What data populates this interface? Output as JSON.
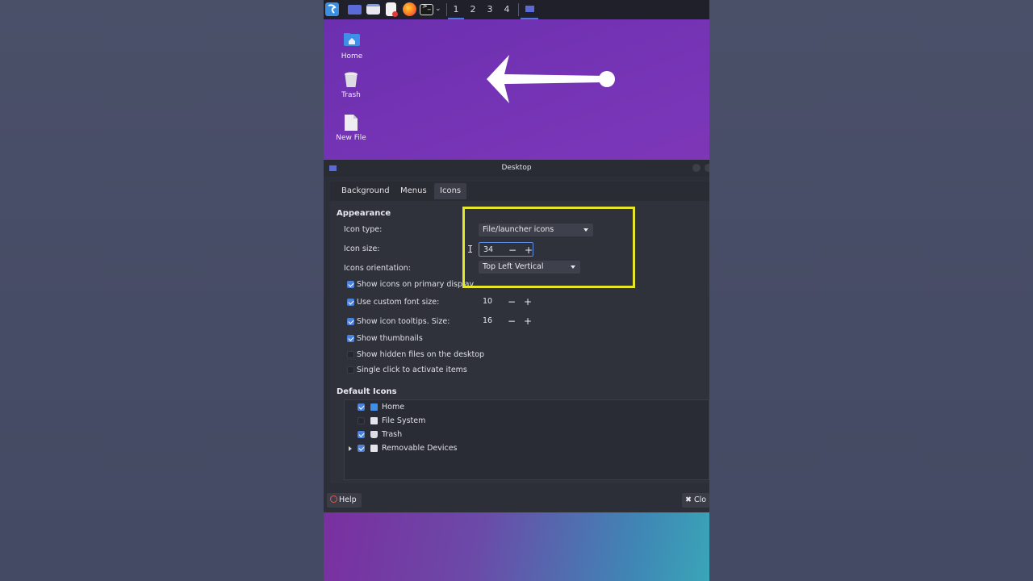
{
  "taskbar": {
    "workspaces": [
      "1",
      "2",
      "3",
      "4"
    ],
    "active_workspace": "1",
    "icons": [
      "app-menu-icon",
      "desktop-icon",
      "file-manager-icon",
      "text-editor-icon",
      "firefox-icon",
      "terminal-icon",
      "chevron-down-icon",
      "window-icon"
    ]
  },
  "desktop": {
    "icons": [
      {
        "label": "Home",
        "icon": "home-folder-icon"
      },
      {
        "label": "Trash",
        "icon": "trash-icon"
      },
      {
        "label": "New File",
        "icon": "file-icon"
      }
    ]
  },
  "dialog": {
    "title": "Desktop",
    "tabs": [
      "Background",
      "Menus",
      "Icons"
    ],
    "active_tab": "Icons",
    "appearance": {
      "heading": "Appearance",
      "icon_type_label": "Icon type:",
      "icon_type_value": "File/launcher icons",
      "icon_size_label": "Icon size:",
      "icon_size_value": "34",
      "orientation_label": "Icons orientation:",
      "orientation_value": "Top Left Vertical",
      "options": [
        {
          "label": "Show icons on primary display",
          "checked": true
        },
        {
          "label": "Use custom font size:",
          "checked": true,
          "value": "10"
        },
        {
          "label": "Show icon tooltips. Size:",
          "checked": true,
          "value": "16"
        },
        {
          "label": "Show thumbnails",
          "checked": true
        },
        {
          "label": "Show hidden files on the desktop",
          "checked": false
        },
        {
          "label": "Single click to activate items",
          "checked": false
        }
      ]
    },
    "default_icons": {
      "heading": "Default Icons",
      "items": [
        {
          "label": "Home",
          "checked": true,
          "icon": "home-icon"
        },
        {
          "label": "File System",
          "checked": false,
          "icon": "drive-icon"
        },
        {
          "label": "Trash",
          "checked": true,
          "icon": "trash-icon"
        },
        {
          "label": "Removable Devices",
          "checked": true,
          "icon": "removable-drive-icon",
          "expandable": true
        }
      ]
    },
    "help_label": "Help",
    "close_label": "Clo"
  },
  "colors": {
    "accent": "#4a82de",
    "highlight_box": "#e6e62a",
    "dialog_bg": "#2d2f38"
  }
}
